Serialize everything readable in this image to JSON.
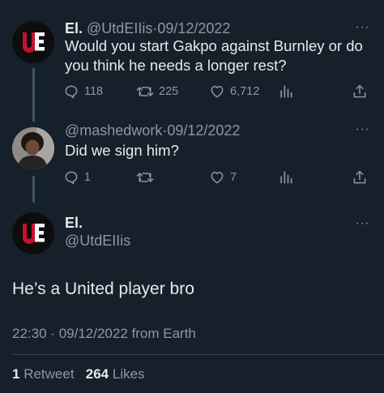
{
  "tweets": [
    {
      "name": "El.",
      "handle": "@UtdEIIis",
      "date": "09/12/2022",
      "separator": "·",
      "text_line1": "Would you start Gakpo against Burnley or do",
      "text_line2": "you think he needs a longer rest?",
      "replies": "118",
      "retweets": "225",
      "likes": "6,712",
      "more": "···"
    },
    {
      "handle": "@mashedwork",
      "date": "09/12/2022",
      "separator": "·",
      "text": "Did we sign him?",
      "replies": "1",
      "retweets": "",
      "likes": "7",
      "more": "···"
    }
  ],
  "main": {
    "name": "El.",
    "handle": "@UtdEIIis",
    "text": "He’s a United player bro",
    "time": "22:30",
    "separator": "·",
    "date": "09/12/2022",
    "source": "from Earth",
    "retweets_count": "1",
    "retweets_label": "Retweet",
    "likes_count": "264",
    "likes_label": "Likes",
    "more": "···"
  },
  "colors": {
    "background": "#15202b",
    "text": "#e7e9ea",
    "muted": "#8b98a5",
    "logo_red": "#c8102e"
  },
  "icons": [
    "ue-logo",
    "reply-icon",
    "retweet-icon",
    "like-icon",
    "analytics-icon",
    "share-icon",
    "more-icon"
  ]
}
